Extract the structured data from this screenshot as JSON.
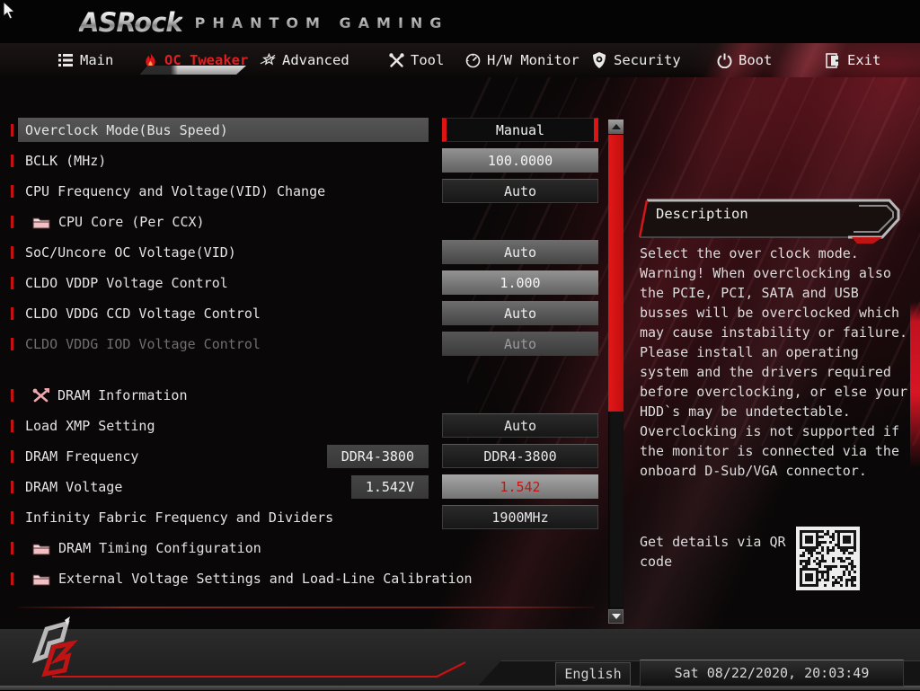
{
  "colors": {
    "accent_red": "#d81a1a",
    "nav_active": "#e02020",
    "value_red_text": "#c41414"
  },
  "brand": {
    "name": "ASRock",
    "series": "PHANTOM GAMING"
  },
  "nav": {
    "tabs": [
      {
        "label": "Main",
        "icon": "list-icon",
        "active": false
      },
      {
        "label": "OC Tweaker",
        "icon": "flame-icon",
        "active": true
      },
      {
        "label": "Advanced",
        "icon": "star-icon",
        "active": false
      },
      {
        "label": "Tool",
        "icon": "tools-icon",
        "active": false
      },
      {
        "label": "H/W Monitor",
        "icon": "gauge-icon",
        "active": false
      },
      {
        "label": "Security",
        "icon": "shield-icon",
        "active": false
      },
      {
        "label": "Boot",
        "icon": "power-icon",
        "active": false
      },
      {
        "label": "Exit",
        "icon": "exit-icon",
        "active": false
      }
    ]
  },
  "settings": {
    "rows": [
      {
        "label": "Overclock Mode(Bus Speed)",
        "value": "Manual",
        "style": "selected",
        "selected": true
      },
      {
        "label": "BCLK (MHz)",
        "value": "100.0000",
        "style": "light"
      },
      {
        "label": "CPU Frequency and Voltage(VID) Change",
        "value": "Auto",
        "style": "dark"
      },
      {
        "label": "CPU Core (Per CCX)",
        "icon": "folder"
      },
      {
        "label": "SoC/Uncore OC Voltage(VID)",
        "value": "Auto",
        "style": "medium"
      },
      {
        "label": "CLDO VDDP Voltage Control",
        "value": "1.000",
        "style": "light"
      },
      {
        "label": "CLDO VDDG CCD Voltage Control",
        "value": "Auto",
        "style": "medium"
      },
      {
        "label": "CLDO VDDG IOD Voltage Control",
        "value": "Auto",
        "style": "disabled",
        "disabled": true
      },
      {
        "spacer": true
      },
      {
        "label": "DRAM Information",
        "icon": "tools"
      },
      {
        "label": "Load XMP Setting",
        "value": "Auto",
        "style": "dark"
      },
      {
        "label": "DRAM Frequency",
        "inline": "DDR4-3800",
        "value": "DDR4-3800",
        "style": "dark"
      },
      {
        "label": "DRAM Voltage",
        "inline": "1.542V",
        "value": "1.542",
        "style": "light-red"
      },
      {
        "label": "Infinity Fabric Frequency and Dividers",
        "value": "1900MHz",
        "style": "dark"
      },
      {
        "label": "DRAM Timing Configuration",
        "icon": "folder"
      },
      {
        "label": "External Voltage Settings and Load-Line Calibration",
        "icon": "folder"
      }
    ]
  },
  "description": {
    "title": "Description",
    "body": "Select the over clock mode.\nWarning! When overclocking also\nthe PCIe, PCI, SATA and USB\nbusses will be overclocked which\nmay cause instability or failure.\nPlease install an operating\nsystem and the drivers required\nbefore overclocking, or else your\nHDD`s may be undetectable.\nOverclocking is not supported if\nthe monitor is connected via the\nonboard D-Sub/VGA connector.",
    "qr_hint": "Get details via QR code"
  },
  "footer": {
    "language": "English",
    "datetime": "Sat 08/22/2020, 20:03:49"
  }
}
